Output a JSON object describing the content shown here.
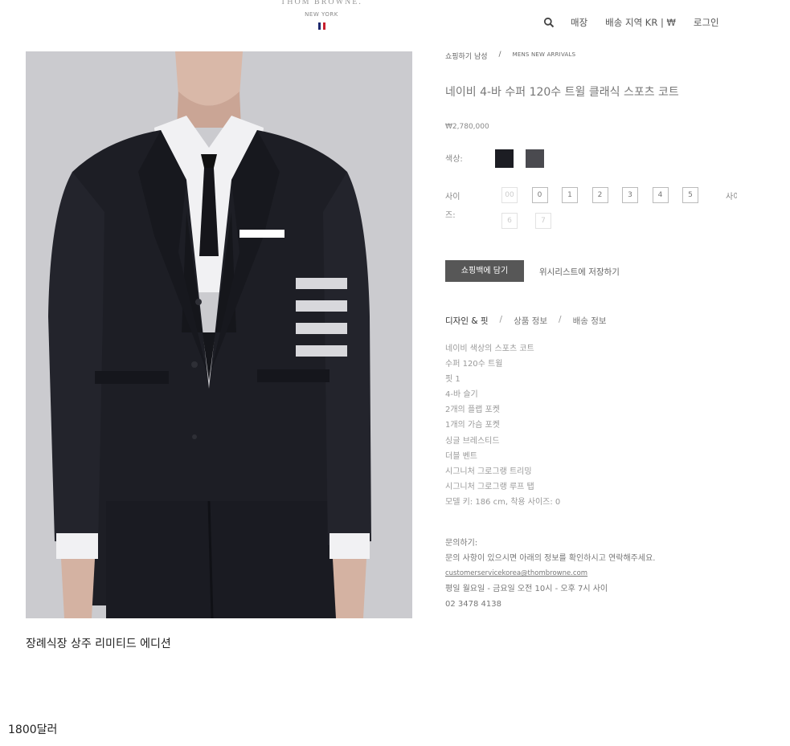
{
  "header": {
    "brand_name": "THOM BROWNE.",
    "brand_sub": "NEW YORK",
    "flag_colors": [
      "#1e2a6e",
      "#ffffff",
      "#c8202f"
    ],
    "search_icon": "search-icon",
    "nav": {
      "stores": "매장",
      "shipping_region": "배송 지역 KR | ₩",
      "login": "로그인"
    }
  },
  "product": {
    "breadcrumb": [
      "쇼핑하기 남성",
      "MENS NEW ARRIVALS"
    ],
    "breadcrumb_separator": "/",
    "title": "네이비 4-바 수퍼 120수 트윌 클래식 스포츠 코트",
    "price": "₩2,780,000",
    "color_label": "색상:",
    "colors": [
      "#1c1d23",
      "#4a4a4f"
    ],
    "size_label": "사이즈:",
    "sizes_row1": [
      {
        "label": "00",
        "available": false
      },
      {
        "label": "0",
        "available": true
      },
      {
        "label": "1",
        "available": true
      },
      {
        "label": "2",
        "available": true
      },
      {
        "label": "3",
        "available": true
      },
      {
        "label": "4",
        "available": true
      },
      {
        "label": "5",
        "available": true
      }
    ],
    "sizes_row2": [
      {
        "label": "6",
        "available": false
      },
      {
        "label": "7",
        "available": false
      }
    ],
    "size_extra": "사이즈",
    "add_to_bag": "쇼핑백에 담기",
    "wishlist": "위시리스트에 저장하기",
    "tabs": [
      "디자인 & 핏",
      "상품 정보",
      "배송 정보"
    ],
    "description": [
      "네이비 색상의 스포츠 코트",
      "수퍼 120수 트윌",
      "핏 1",
      "4-바 슬기",
      "2개의 플랩 포켓",
      "1개의 가슴 포켓",
      "싱글 브레스티드",
      "더블 벤트",
      "시그니처 그로그랭 트리밍",
      "시그니처 그로그랭 루프 탭",
      "모델 키: 186 cm, 착용 사이즈: 0"
    ],
    "contact": {
      "heading": "문의하기:",
      "message": "문의 사항이 있으시면 아래의 정보를 확인하시고 연락해주세요.",
      "email": "customerservicekorea@thombrowne.com",
      "hours": "평일 월요일 - 금요일 오전 10시 - 오후 7시 사이",
      "phone": "02 3478 4138"
    }
  },
  "photo_caption": "장례식장 상주 리미티드 에디션",
  "price_note": "1800달러"
}
